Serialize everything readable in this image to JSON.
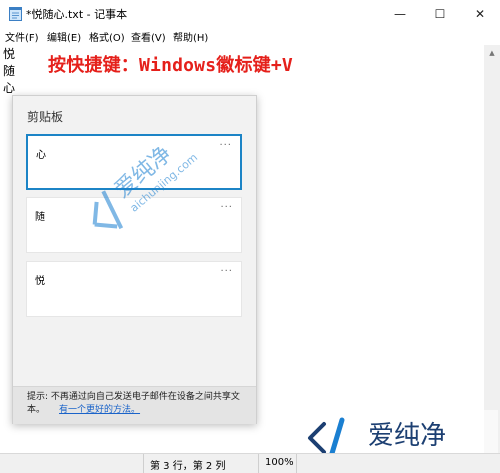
{
  "window": {
    "title": "*悦随心.txt - 记事本",
    "minimize_glyph": "—",
    "maximize_glyph": "☐",
    "close_glyph": "✕"
  },
  "menu": {
    "items": [
      "文件(F)",
      "编辑(E)",
      "格式(O)",
      "查看(V)",
      "帮助(H)"
    ]
  },
  "document": {
    "lines": [
      "悦",
      "随",
      "心"
    ]
  },
  "annotation": "按快捷键：Windows徽标键+V",
  "clipboard": {
    "title": "剪贴板",
    "items": [
      {
        "text": "心",
        "selected": true
      },
      {
        "text": "随",
        "selected": false
      },
      {
        "text": "悦",
        "selected": false
      }
    ],
    "more_glyph": "···",
    "tip": "提示: 不再通过向自己发送电子邮件在设备之间共享文本。",
    "link": "有一个更好的方法。"
  },
  "watermark": {
    "brand_cn": "爱纯净",
    "brand_url": "aichunjing.com",
    "colors": {
      "blue": "#1a7fd1",
      "dark": "#1c3f72"
    }
  },
  "status": {
    "position": "第 3 行，第 2 列",
    "zoom": "100%"
  },
  "colors": {
    "annotation": "#e5201b",
    "selection_border": "#1c84c6",
    "link": "#1a63c9"
  }
}
